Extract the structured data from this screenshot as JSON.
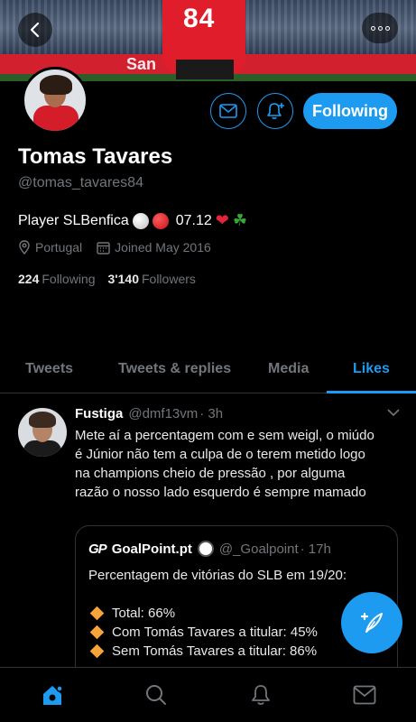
{
  "banner": {
    "ad_text": "San",
    "jersey_number": "84"
  },
  "header": {
    "back_icon": "back-arrow-icon",
    "more_icon": "more-horizontal-icon",
    "message_icon": "envelope-icon",
    "notify_icon": "bell-plus-icon",
    "follow_label": "Following"
  },
  "profile": {
    "name": "Tomas Tavares",
    "handle": "@tomas_tavares84",
    "bio_prefix": "Player SLBenfica",
    "bio_date": "07.12",
    "location": "Portugal",
    "joined": "Joined May 2016",
    "following_count": "224",
    "following_label": "Following",
    "followers_count": "3'140",
    "followers_label": "Followers"
  },
  "tabs": [
    {
      "label": "Tweets",
      "active": false
    },
    {
      "label": "Tweets & replies",
      "active": false
    },
    {
      "label": "Media",
      "active": false
    },
    {
      "label": "Likes",
      "active": true
    }
  ],
  "tweet": {
    "author_name": "Fustiga",
    "author_handle": "@dmf13vm",
    "time": "· 3h",
    "text": "Mete aí a percentagem com e sem weigl, o miúdo é Júnior não tem a culpa de o terem metido logo na champions cheio de pressão , por alguma razão o nosso lado esquerdo é sempre mamado",
    "quote": {
      "logo": "GP",
      "name": "GoalPoint.pt",
      "handle": "@_Goalpoint",
      "time": "· 17h",
      "intro": "Percentagem de vitórias do SLB em 19/20:",
      "lines": [
        "Total: 66%",
        "Com Tomás Tavares a titular: 45%",
        "Sem Tomás Tavares a titular: 86%"
      ]
    }
  },
  "fab_icon": "compose-tweet-icon",
  "nav": {
    "home_icon": "home-icon",
    "search_icon": "search-icon",
    "notifications_icon": "bell-icon",
    "messages_icon": "envelope-icon"
  },
  "colors": {
    "accent": "#1d9bf0",
    "background": "#000000",
    "secondary_text": "#71767b",
    "divider": "#2f3336"
  }
}
